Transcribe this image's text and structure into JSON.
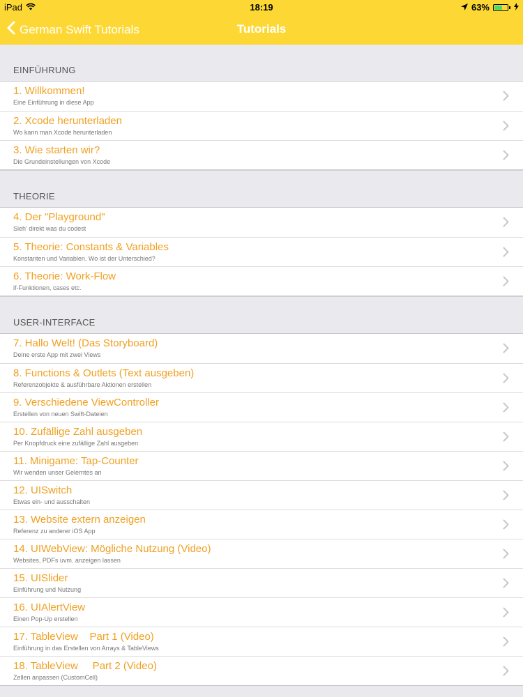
{
  "status_bar": {
    "device": "iPad",
    "time": "18:19",
    "battery": "63%",
    "battery_level": 0.63,
    "wifi_icon": "wifi-icon",
    "location_icon": "location-arrow-icon",
    "charging_icon": "charging-bolt-icon"
  },
  "nav": {
    "back_label": "German Swift Tutorials",
    "title": "Tutorials"
  },
  "colors": {
    "accent": "#fdd835",
    "row_title": "#f0a022"
  },
  "sections": [
    {
      "header": "EINFÜHRUNG",
      "rows": [
        {
          "title": "1. Willkommen!",
          "subtitle": "Eine Einführung in diese App"
        },
        {
          "title": "2. Xcode herunterladen",
          "subtitle": "Wo kann man Xcode herunterladen"
        },
        {
          "title": "3. Wie starten wir?",
          "subtitle": "Die Grundeinstellungen von Xcode"
        }
      ]
    },
    {
      "header": "THEORIE",
      "rows": [
        {
          "title": "4. Der \"Playground\"",
          "subtitle": "Sieh' direkt was du codest"
        },
        {
          "title": "5. Theorie: Constants & Variables",
          "subtitle": "Konstanten und Variablen. Wo ist der Unterschied?"
        },
        {
          "title": "6. Theorie: Work-Flow",
          "subtitle": "if-Funktionen, cases etc."
        }
      ]
    },
    {
      "header": "USER-INTERFACE",
      "rows": [
        {
          "title": "7. Hallo Welt! (Das Storyboard)",
          "subtitle": "Deine erste App mit zwei Views"
        },
        {
          "title": "8. Functions & Outlets (Text ausgeben)",
          "subtitle": "Referenzobjekte & ausführbare Aktionen erstellen"
        },
        {
          "title": "9. Verschiedene ViewController",
          "subtitle": "Erstellen von neuen Swift-Dateien"
        },
        {
          "title": "10. Zufällige Zahl ausgeben",
          "subtitle": "Per Knopfdruck eine zufällige Zahl ausgeben"
        },
        {
          "title": "11. Minigame: Tap-Counter",
          "subtitle": "Wir wenden unser Gelerntes an"
        },
        {
          "title": "12. UISwitch",
          "subtitle": "Etwas ein- und ausschalten"
        },
        {
          "title": "13. Website extern anzeigen",
          "subtitle": "Referenz zu anderer iOS App"
        },
        {
          "title": "14. UIWebView: Mögliche Nutzung (Video)",
          "subtitle": "Websites, PDFs uvm. anzeigen lassen"
        },
        {
          "title": "15. UISlider",
          "subtitle": "Einführung und Nutzung"
        },
        {
          "title": "16. UIAlertView",
          "subtitle": "Einen Pop-Up erstellen"
        },
        {
          "title": "17. TableView    Part 1 (Video)",
          "subtitle": "Einführung in das Erstellen von Arrays & TableViews"
        },
        {
          "title": "18. TableView     Part 2 (Video)",
          "subtitle": "Zellen anpassen (CustomCell)"
        }
      ]
    }
  ]
}
